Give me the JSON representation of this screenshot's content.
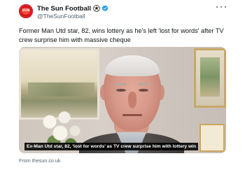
{
  "account": {
    "display_name": "The Sun Football",
    "handle": "@TheSunFootball",
    "name_emoji_icon": "football-icon",
    "verified_icon": "verified-badge-icon",
    "verified_color": "#1d9bf0",
    "avatar_icon": "the-sun-logo-icon",
    "brand_color": "#e32a2b"
  },
  "tweet": {
    "text": "Former Man Utd star, 82, wins lottery as he's left 'lost for words' after TV crew surprise him with massive cheque"
  },
  "media": {
    "caption": "Ex-Man Utd star, 82, 'lost for words' as TV crew surprise him with lottery win"
  },
  "link_card": {
    "source": "From thesun.co.uk"
  },
  "menu": {
    "more_icon": "more-options-icon"
  }
}
